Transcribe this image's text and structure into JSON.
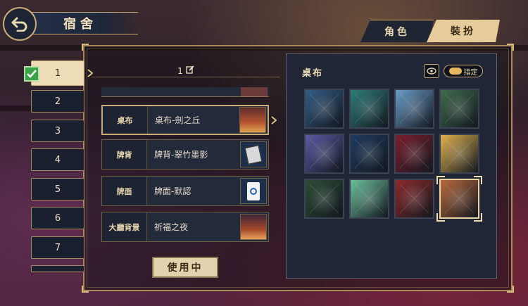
{
  "header": {
    "title": "宿舍"
  },
  "tabs": [
    {
      "label": "角色",
      "active": false
    },
    {
      "label": "裝扮",
      "active": true
    }
  ],
  "slots": [
    {
      "label": "1",
      "active": true,
      "checked": true
    },
    {
      "label": "2"
    },
    {
      "label": "3"
    },
    {
      "label": "4"
    },
    {
      "label": "5"
    },
    {
      "label": "6"
    },
    {
      "label": "7"
    }
  ],
  "preset": {
    "label": "1"
  },
  "items": [
    {
      "category": "桌布",
      "name": "桌布-劍之丘",
      "selected": true
    },
    {
      "category": "牌背",
      "name": "牌背-翠竹墨影"
    },
    {
      "category": "牌面",
      "name": "牌面-默認"
    },
    {
      "category": "大廳背景",
      "name": "祈福之夜"
    }
  ],
  "in_use_button": "使用中",
  "panel": {
    "title": "桌布",
    "pin_label": "指定",
    "selected_index": 11,
    "tiles": [
      {
        "theme": "blue-plain",
        "color": "#335d85"
      },
      {
        "theme": "teal-plain",
        "color": "#2f7d78"
      },
      {
        "theme": "wave",
        "color": "#6a9dc8"
      },
      {
        "theme": "green-floral",
        "color": "#3f6a4c"
      },
      {
        "theme": "galaxy",
        "color": "#5a5aa3"
      },
      {
        "theme": "night-stars",
        "color": "#1f3c60"
      },
      {
        "theme": "crimson-plain",
        "color": "#7a1f2c"
      },
      {
        "theme": "moon-character",
        "color": "#e0b24e"
      },
      {
        "theme": "bamboo-forest",
        "color": "#2c4d36"
      },
      {
        "theme": "mint-pandas",
        "color": "#6cbf9c"
      },
      {
        "theme": "red-plum",
        "color": "#8e2a2a"
      },
      {
        "theme": "sunset-hill",
        "color": "#b86a3d"
      }
    ]
  }
}
